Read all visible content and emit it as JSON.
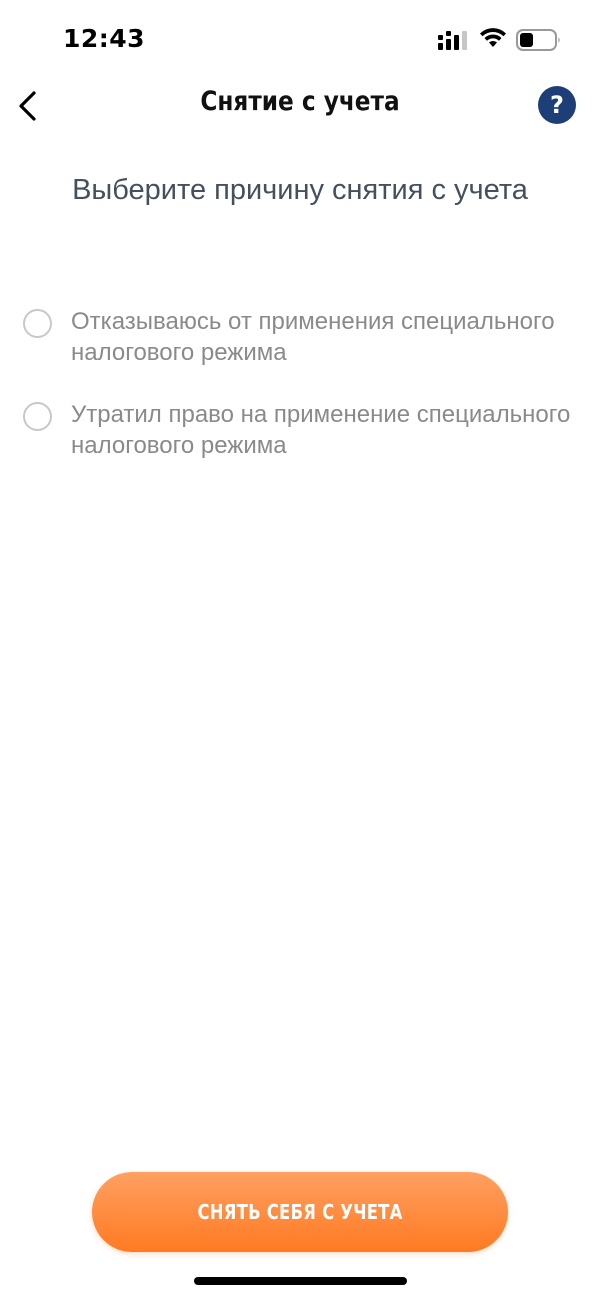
{
  "status_bar": {
    "time": "12:43",
    "signal_icon": "cellular-signal-icon",
    "wifi_icon": "wifi-icon",
    "battery_icon": "battery-icon",
    "battery_level": 0.35
  },
  "header": {
    "back_icon": "chevron-left-icon",
    "title": "Снятие с учета",
    "help_icon": "question-mark-icon",
    "help_glyph": "?"
  },
  "main": {
    "heading": "Выберите причину снятия с учета",
    "options": [
      {
        "label": "Отказываюсь от применения специального налогового режима",
        "selected": false
      },
      {
        "label": "Утратил право на применение специального налогового режима",
        "selected": false
      }
    ]
  },
  "footer": {
    "submit_label": "СНЯТЬ СЕБЯ С УЧЕТА"
  },
  "colors": {
    "accent_orange": "#ff7a22",
    "help_blue": "#1d3e76",
    "heading_text": "#45505e",
    "option_text": "#8a8a8e"
  }
}
